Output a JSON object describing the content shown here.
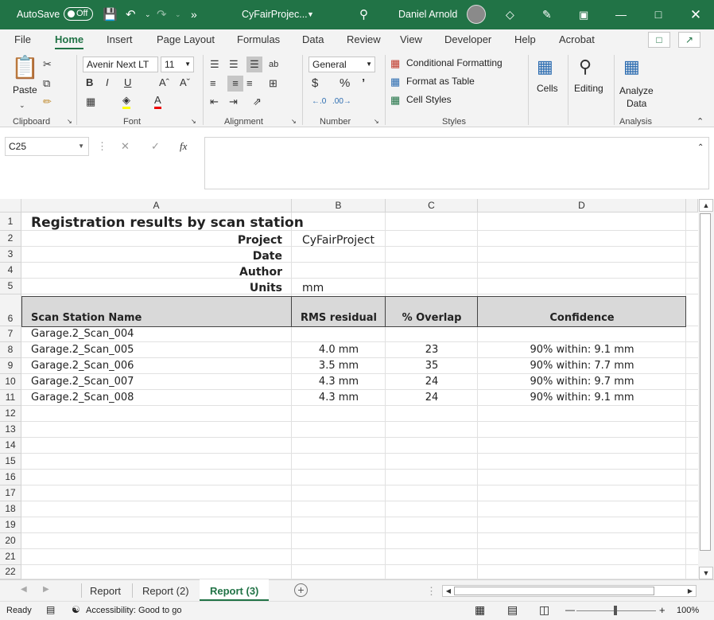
{
  "titlebar": {
    "autosave_label": "AutoSave",
    "autosave_state": "Off",
    "filename": "CyFairProjec...",
    "user": "Daniel Arnold"
  },
  "tabs": [
    "File",
    "Home",
    "Insert",
    "Page Layout",
    "Formulas",
    "Data",
    "Review",
    "View",
    "Developer",
    "Help",
    "Acrobat"
  ],
  "active_tab": "Home",
  "ribbon": {
    "clipboard": {
      "paste": "Paste",
      "group": "Clipboard"
    },
    "font": {
      "name": "Avenir Next LT",
      "size": "11",
      "group": "Font"
    },
    "alignment": {
      "group": "Alignment"
    },
    "number": {
      "format": "General",
      "group": "Number"
    },
    "styles": {
      "conditional": "Conditional Formatting",
      "format_table": "Format as Table",
      "cell_styles": "Cell Styles",
      "group": "Styles"
    },
    "cells": {
      "label": "Cells"
    },
    "editing": {
      "label": "Editing"
    },
    "analysis": {
      "line1": "Analyze",
      "line2": "Data",
      "group": "Analysis"
    }
  },
  "formula_bar": {
    "name_box": "C25",
    "value": ""
  },
  "columns": [
    "A",
    "B",
    "C",
    "D"
  ],
  "rows": [
    "1",
    "2",
    "3",
    "4",
    "5",
    "6",
    "7",
    "8",
    "9",
    "10",
    "11",
    "12",
    "13",
    "14",
    "15",
    "16",
    "17",
    "18",
    "19",
    "20",
    "21",
    "22"
  ],
  "sheet": {
    "title": "Registration results by scan station",
    "meta": [
      {
        "label": "Project",
        "value": "CyFairProject"
      },
      {
        "label": "Date",
        "value": ""
      },
      {
        "label": "Author",
        "value": ""
      },
      {
        "label": "Units",
        "value": "mm"
      }
    ],
    "headers": [
      "Scan Station Name",
      "RMS residual",
      "% Overlap",
      "Confidence"
    ],
    "table": [
      [
        "Garage.2_Scan_004",
        "",
        "",
        ""
      ],
      [
        "Garage.2_Scan_005",
        "4.0 mm",
        "23",
        "90% within: 9.1 mm"
      ],
      [
        "Garage.2_Scan_006",
        "3.5 mm",
        "35",
        "90% within: 7.7 mm"
      ],
      [
        "Garage.2_Scan_007",
        "4.3 mm",
        "24",
        "90% within: 9.7 mm"
      ],
      [
        "Garage.2_Scan_008",
        "4.3 mm",
        "24",
        "90% within: 9.1 mm"
      ]
    ]
  },
  "sheet_tabs": [
    "Report",
    "Report (2)",
    "Report (3)"
  ],
  "active_sheet": "Report (3)",
  "status": {
    "ready": "Ready",
    "accessibility": "Accessibility: Good to go",
    "zoom": "100%"
  },
  "colors": {
    "brand": "#217346",
    "header_fill": "#d9d9d9"
  }
}
